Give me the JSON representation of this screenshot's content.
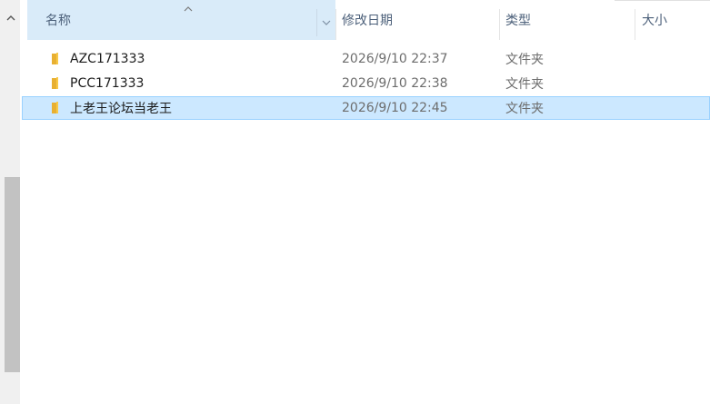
{
  "columns": {
    "name": "名称",
    "date": "修改日期",
    "type": "类型",
    "size": "大小"
  },
  "sort_indicator": "^",
  "files": [
    {
      "name": "AZC171333",
      "date": "2026/9/10 22:37",
      "type": "文件夹",
      "icon": "folder-icon",
      "selected": false
    },
    {
      "name": "PCC171333",
      "date": "2026/9/10 22:38",
      "type": "文件夹",
      "icon": "folder-icon",
      "selected": false
    },
    {
      "name": "上老王论坛当老王",
      "date": "2026/9/10 22:45",
      "type": "文件夹",
      "icon": "folder-icon",
      "selected": true
    }
  ],
  "colors": {
    "header_selected": "#d9ebf9",
    "row_selected": "#cce8ff",
    "row_selected_border": "#99d1ff",
    "folder": "#f8c948"
  }
}
